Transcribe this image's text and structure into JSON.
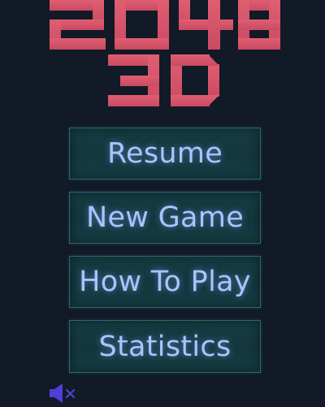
{
  "logo": {
    "line1": "2048",
    "line2": "3D",
    "color": "#d9566a"
  },
  "menu": {
    "buttons": [
      {
        "label": "Resume"
      },
      {
        "label": "New Game"
      },
      {
        "label": "How To Play"
      },
      {
        "label": "Statistics"
      }
    ],
    "text_color": "#a9c4ff",
    "button_color": "#173d44"
  },
  "sound": {
    "icon": "speaker-muted-icon",
    "color": "#4f3fd6"
  }
}
